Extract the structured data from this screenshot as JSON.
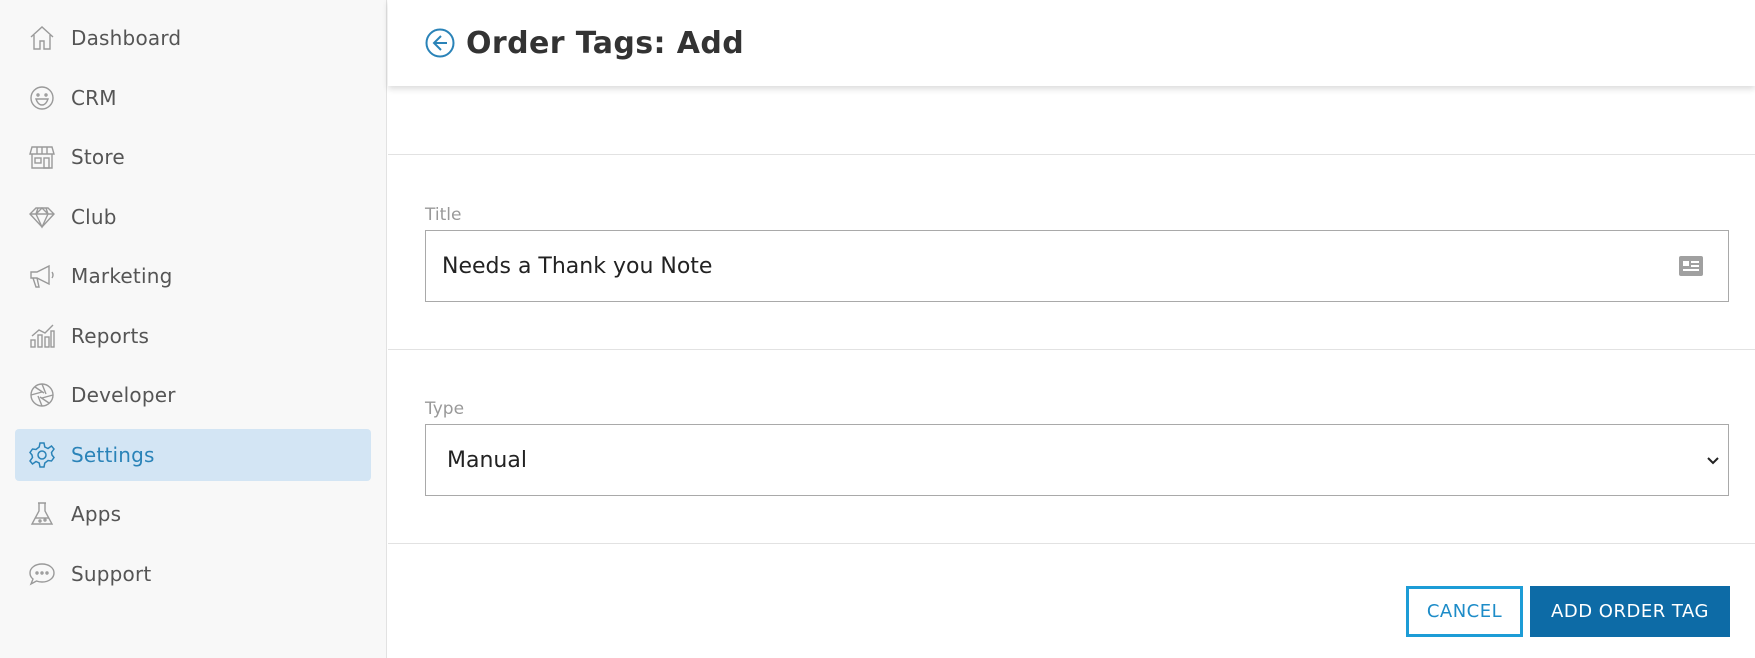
{
  "sidebar": {
    "items": [
      {
        "label": "Dashboard",
        "icon": "home-icon",
        "active": false
      },
      {
        "label": "CRM",
        "icon": "smiley-icon",
        "active": false
      },
      {
        "label": "Store",
        "icon": "store-icon",
        "active": false
      },
      {
        "label": "Club",
        "icon": "diamond-icon",
        "active": false
      },
      {
        "label": "Marketing",
        "icon": "megaphone-icon",
        "active": false
      },
      {
        "label": "Reports",
        "icon": "bar-chart-icon",
        "active": false
      },
      {
        "label": "Developer",
        "icon": "aperture-icon",
        "active": false
      },
      {
        "label": "Settings",
        "icon": "gear-icon",
        "active": true
      },
      {
        "label": "Apps",
        "icon": "flask-icon",
        "active": false
      },
      {
        "label": "Support",
        "icon": "chat-bubble-icon",
        "active": false
      }
    ]
  },
  "header": {
    "title_prefix": "Order Tags:",
    "title_action": "Add"
  },
  "form": {
    "title": {
      "label": "Title",
      "value": "Needs a Thank you Note"
    },
    "type": {
      "label": "Type",
      "value": "Manual"
    }
  },
  "actions": {
    "cancel_label": "CANCEL",
    "submit_label": "ADD ORDER TAG"
  },
  "colors": {
    "accent": "#2a83b8",
    "primary_button": "#0d6ba6",
    "active_nav_bg": "#d3e5f4"
  }
}
